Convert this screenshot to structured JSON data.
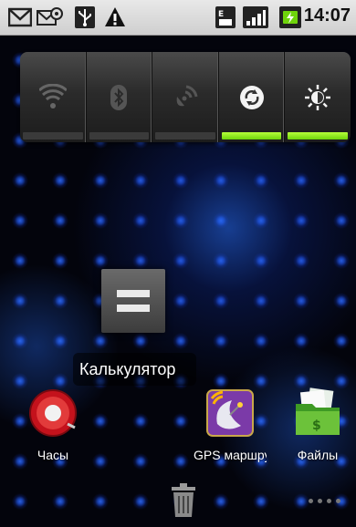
{
  "statusbar": {
    "time": "14:07",
    "icons": [
      "gmail-icon",
      "mail-at-icon",
      "usb-icon",
      "warning-icon",
      "sim-data-icon",
      "signal-icon",
      "battery-charging-icon"
    ]
  },
  "power_widget": {
    "buttons": [
      {
        "name": "wifi-toggle",
        "icon": "wifi-icon",
        "on": false
      },
      {
        "name": "bluetooth-toggle",
        "icon": "bluetooth-icon",
        "on": false
      },
      {
        "name": "gps-toggle",
        "icon": "gps-icon",
        "on": false
      },
      {
        "name": "sync-toggle",
        "icon": "sync-icon",
        "on": true
      },
      {
        "name": "brightness-toggle",
        "icon": "brightness-icon",
        "on": true
      }
    ],
    "accent_on": "#8fe61f"
  },
  "drag": {
    "label": "Калькулятор"
  },
  "apps": {
    "clock": {
      "label": "Часы"
    },
    "gps": {
      "label": "GPS маршруты"
    },
    "files": {
      "label": "Файлы"
    }
  },
  "dock": {
    "trash_icon": "trash-icon",
    "menu_icon": "more-dots-icon"
  }
}
